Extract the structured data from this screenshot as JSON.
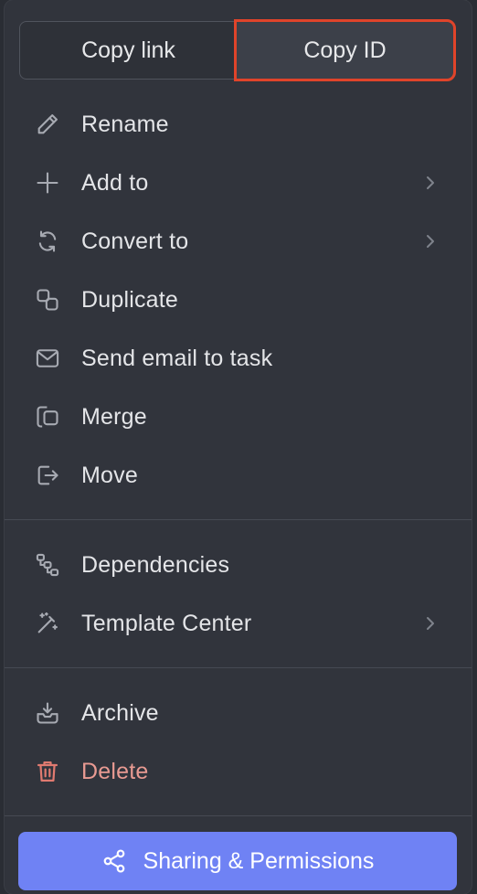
{
  "segment": {
    "copy_link": "Copy link",
    "copy_id": "Copy ID"
  },
  "items": [
    {
      "label": "Rename",
      "icon": "pencil-icon"
    },
    {
      "label": "Add to",
      "icon": "plus-icon"
    },
    {
      "label": "Convert to",
      "icon": "convert-icon"
    },
    {
      "label": "Duplicate",
      "icon": "duplicate-icon"
    },
    {
      "label": "Send email to task",
      "icon": "mail-icon"
    },
    {
      "label": "Merge",
      "icon": "merge-icon"
    },
    {
      "label": "Move",
      "icon": "move-icon"
    },
    {
      "label": "Dependencies",
      "icon": "dependencies-icon"
    },
    {
      "label": "Template Center",
      "icon": "magic-wand-icon"
    },
    {
      "label": "Archive",
      "icon": "archive-icon"
    },
    {
      "label": "Delete",
      "icon": "trash-icon"
    }
  ],
  "share": {
    "label": "Sharing & Permissions",
    "icon": "share-icon"
  },
  "colors": {
    "menu_bg": "#31343c",
    "text": "#e4e5e8",
    "danger": "#e89a92",
    "accent": "#6f82f4",
    "highlight": "#e0442a"
  }
}
